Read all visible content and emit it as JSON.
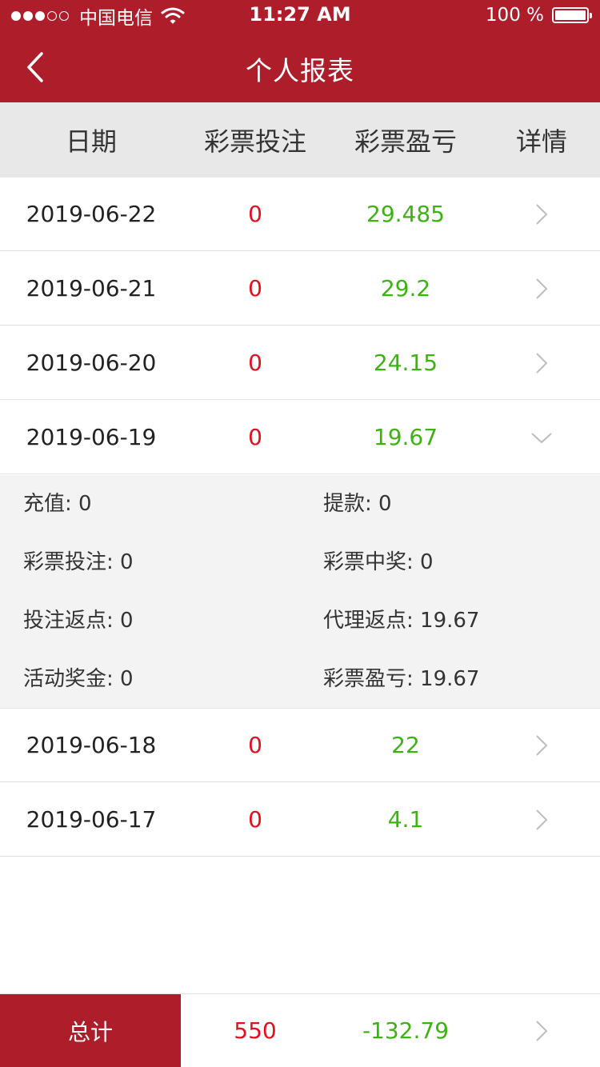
{
  "status_bar": {
    "carrier": "中国电信",
    "time": "11:27 AM",
    "battery": "100 %"
  },
  "nav": {
    "title": "个人报表"
  },
  "table": {
    "headers": [
      "日期",
      "彩票投注",
      "彩票盈亏",
      "详情"
    ],
    "rows": [
      {
        "date": "2019-06-22",
        "bet": "0",
        "profit": "29.485"
      },
      {
        "date": "2019-06-21",
        "bet": "0",
        "profit": "29.2"
      },
      {
        "date": "2019-06-20",
        "bet": "0",
        "profit": "24.15"
      },
      {
        "date": "2019-06-19",
        "bet": "0",
        "profit": "19.67"
      },
      {
        "date": "2019-06-18",
        "bet": "0",
        "profit": "22"
      },
      {
        "date": "2019-06-17",
        "bet": "0",
        "profit": "4.1"
      }
    ],
    "expanded_detail": {
      "items": [
        "充值: 0",
        "提款: 0",
        "彩票投注: 0",
        "彩票中奖: 0",
        "投注返点: 0",
        "代理返点: 19.67",
        "活动奖金: 0",
        "彩票盈亏: 19.67"
      ]
    }
  },
  "footer": {
    "label": "总计",
    "bet_total": "550",
    "profit_total": "-132.79"
  },
  "colors": {
    "brand_red": "#ae1e2a",
    "bet_red": "#e0121e",
    "profit_green": "#3db213"
  }
}
